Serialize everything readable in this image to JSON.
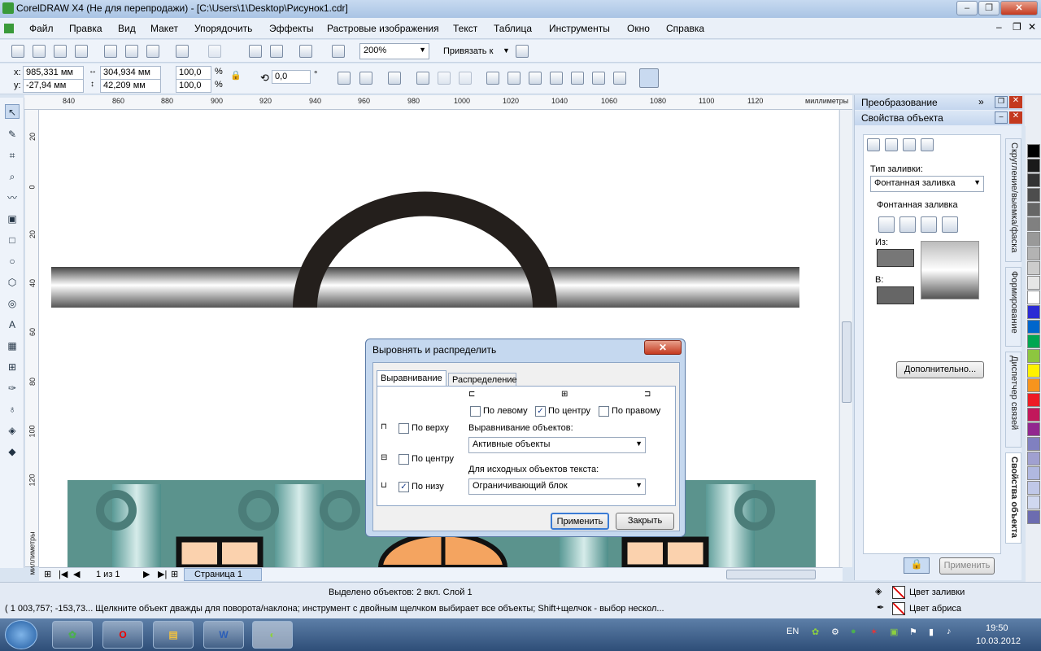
{
  "window": {
    "title": "CorelDRAW X4 (Не для перепродажи) - [C:\\Users\\1\\Desktop\\Рисунок1.cdr]"
  },
  "menu": [
    "Файл",
    "Правка",
    "Вид",
    "Макет",
    "Упорядочить",
    "Эффекты",
    "Растровые изображения",
    "Текст",
    "Таблица",
    "Инструменты",
    "Окно",
    "Справка"
  ],
  "toolbar": {
    "zoom": "200%",
    "snap_label": "Привязать к"
  },
  "propbar": {
    "x_label": "x:",
    "x": "985,331 мм",
    "y_label": "y:",
    "y": "-27,94 мм",
    "w": "304,934 мм",
    "h": "42,209 мм",
    "scale_w": "100,0",
    "scale_h": "100,0",
    "pct1": "%",
    "pct2": "%",
    "angle": "0,0",
    "deg": "°"
  },
  "ruler": {
    "ticks": [
      "840",
      "860",
      "880",
      "900",
      "920",
      "940",
      "960",
      "980",
      "1000",
      "1020",
      "1040",
      "1060",
      "1080",
      "1100",
      "1120"
    ],
    "units": "миллиметры",
    "vticks": [
      "20",
      "0",
      "20",
      "40",
      "60",
      "80",
      "100",
      "120"
    ],
    "vunits": "миллиметры"
  },
  "docker": {
    "panel1": "Преобразование",
    "panel2": "Свойства объекта",
    "fill_type_label": "Тип заливки:",
    "fill_type": "Фонтанная заливка",
    "group_label": "Фонтанная заливка",
    "from_label": "Из:",
    "to_label": "В:",
    "more_button": "Дополнительно...",
    "apply_button": "Применить",
    "tabs": [
      "Скругление/выемка/фаска",
      "Формирование",
      "Диспетчер связей",
      "Свойства объекта"
    ]
  },
  "palette": [
    "#000000",
    "#1a1a1a",
    "#333333",
    "#4d4d4d",
    "#666666",
    "#808080",
    "#999999",
    "#b3b3b3",
    "#cccccc",
    "#e6e6e6",
    "#ffffff",
    "#2b2bd4",
    "#0066cc",
    "#00a651",
    "#8dc63f",
    "#fff200",
    "#f7941d",
    "#ed1c24",
    "#c2185b",
    "#92278f",
    "#8080c0",
    "#a0a0d0",
    "#b0b8e0",
    "#c0c8e8",
    "#d0d8f0",
    "#6c6cb0"
  ],
  "dialog": {
    "title": "Выровнять и распределить",
    "tab_align": "Выравнивание",
    "tab_dist": "Распределение",
    "left": "По левому",
    "hcenter": "По центру",
    "right": "По правому",
    "top": "По верху",
    "vcenter": "По центру",
    "bottom": "По низу",
    "align_objects_label": "Выравнивание объектов:",
    "align_objects": "Активные объекты",
    "text_source_label": "Для исходных объектов текста:",
    "text_source": "Ограничивающий блок",
    "apply": "Применить",
    "close": "Закрыть",
    "checked": {
      "left": false,
      "hcenter": true,
      "right": false,
      "top": false,
      "vcenter": false,
      "bottom": true
    }
  },
  "pages": {
    "counter": "1 из 1",
    "tab": "Страница 1"
  },
  "status": {
    "selected": "Выделено объектов: 2 вкл. Слой 1",
    "hint": "( 1 003,757; -153,73... Щелкните объект дважды для поворота/наклона; инструмент с двойным щелчком выбирает все объекты; Shift+щелчок - выбор нескол...",
    "fill": "Цвет заливки",
    "outline": "Цвет абриса"
  },
  "taskbar": {
    "lang": "EN",
    "time": "19:50",
    "date": "10.03.2012"
  }
}
